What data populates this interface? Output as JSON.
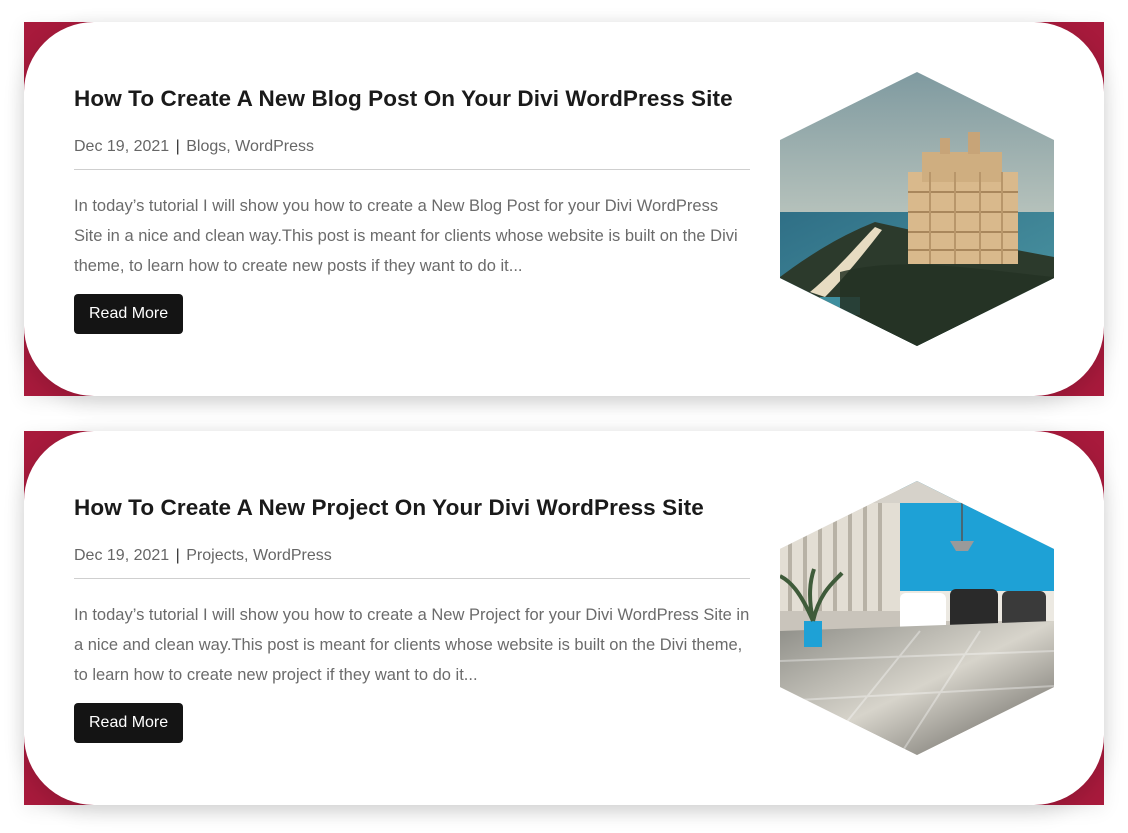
{
  "posts": [
    {
      "title": "How To Create A New Blog Post On Your Divi WordPress Site",
      "date": "Dec 19, 2021",
      "separator": "|",
      "category1": "Blogs",
      "category2": "WordPress",
      "excerpt": "In today’s tutorial I will show you how to create a New Blog Post for your Divi WordPress Site in a nice and clean way.This post is meant for clients whose website is built on the Divi theme, to learn how to create new posts if they want to do it...",
      "read_more": "Read More",
      "image": "resort-hotel-beach-photo"
    },
    {
      "title": "How To Create A New Project On Your Divi WordPress Site",
      "date": "Dec 19, 2021",
      "separator": "|",
      "category1": "Projects",
      "category2": "WordPress",
      "excerpt": "In today’s tutorial I will show you how to create a New Project for your Divi WordPress Site in a nice and clean way.This post is meant for clients whose website is built on the Divi theme, to learn how to create new project if they want to do it...",
      "read_more": "Read More",
      "image": "office-meeting-room-photo"
    }
  ],
  "colors": {
    "accent": "#a81a3c",
    "button_bg": "#141414",
    "title": "#1a1a1a",
    "text": "#6b6b6b"
  }
}
